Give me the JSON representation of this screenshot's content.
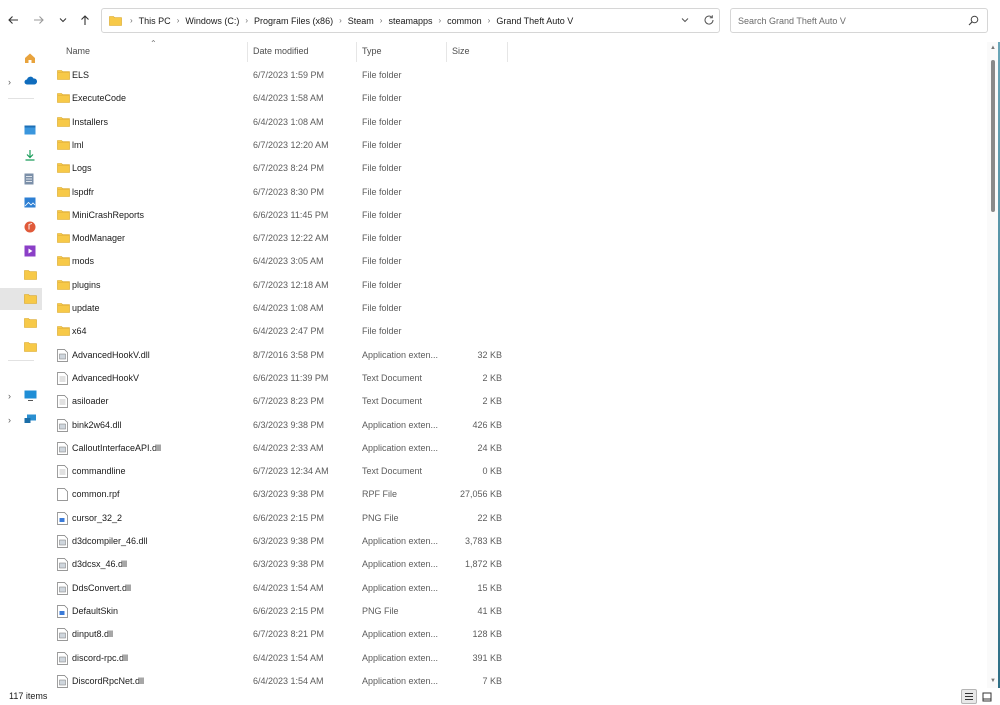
{
  "address": {
    "crumbs": [
      "This PC",
      "Windows (C:)",
      "Program Files (x86)",
      "Steam",
      "steamapps",
      "common",
      "Grand Theft Auto V"
    ]
  },
  "search": {
    "placeholder": "Search Grand Theft Auto V"
  },
  "columns": {
    "name": "Name",
    "date": "Date modified",
    "type": "Type",
    "size": "Size"
  },
  "files": [
    {
      "name": "ELS",
      "date": "6/7/2023 1:59 PM",
      "type": "File folder",
      "size": "",
      "kind": "folder"
    },
    {
      "name": "ExecuteCode",
      "date": "6/4/2023 1:58 AM",
      "type": "File folder",
      "size": "",
      "kind": "folder"
    },
    {
      "name": "Installers",
      "date": "6/4/2023 1:08 AM",
      "type": "File folder",
      "size": "",
      "kind": "folder"
    },
    {
      "name": "lml",
      "date": "6/7/2023 12:20 AM",
      "type": "File folder",
      "size": "",
      "kind": "folder"
    },
    {
      "name": "Logs",
      "date": "6/7/2023 8:24 PM",
      "type": "File folder",
      "size": "",
      "kind": "folder"
    },
    {
      "name": "lspdfr",
      "date": "6/7/2023 8:30 PM",
      "type": "File folder",
      "size": "",
      "kind": "folder"
    },
    {
      "name": "MiniCrashReports",
      "date": "6/6/2023 11:45 PM",
      "type": "File folder",
      "size": "",
      "kind": "folder"
    },
    {
      "name": "ModManager",
      "date": "6/7/2023 12:22 AM",
      "type": "File folder",
      "size": "",
      "kind": "folder"
    },
    {
      "name": "mods",
      "date": "6/4/2023 3:05 AM",
      "type": "File folder",
      "size": "",
      "kind": "folder"
    },
    {
      "name": "plugins",
      "date": "6/7/2023 12:18 AM",
      "type": "File folder",
      "size": "",
      "kind": "folder"
    },
    {
      "name": "update",
      "date": "6/4/2023 1:08 AM",
      "type": "File folder",
      "size": "",
      "kind": "folder"
    },
    {
      "name": "x64",
      "date": "6/4/2023 2:47 PM",
      "type": "File folder",
      "size": "",
      "kind": "folder"
    },
    {
      "name": "AdvancedHookV.dll",
      "date": "8/7/2016 3:58 PM",
      "type": "Application exten...",
      "size": "32 KB",
      "kind": "dll"
    },
    {
      "name": "AdvancedHookV",
      "date": "6/6/2023 11:39 PM",
      "type": "Text Document",
      "size": "2 KB",
      "kind": "txt"
    },
    {
      "name": "asiloader",
      "date": "6/7/2023 8:23 PM",
      "type": "Text Document",
      "size": "2 KB",
      "kind": "txt"
    },
    {
      "name": "bink2w64.dll",
      "date": "6/3/2023 9:38 PM",
      "type": "Application exten...",
      "size": "426 KB",
      "kind": "dll"
    },
    {
      "name": "CalloutInterfaceAPI.dll",
      "date": "6/4/2023 2:33 AM",
      "type": "Application exten...",
      "size": "24 KB",
      "kind": "dll"
    },
    {
      "name": "commandline",
      "date": "6/7/2023 12:34 AM",
      "type": "Text Document",
      "size": "0 KB",
      "kind": "txt"
    },
    {
      "name": "common.rpf",
      "date": "6/3/2023 9:38 PM",
      "type": "RPF File",
      "size": "27,056 KB",
      "kind": "blank"
    },
    {
      "name": "cursor_32_2",
      "date": "6/6/2023 2:15 PM",
      "type": "PNG File",
      "size": "22 KB",
      "kind": "png"
    },
    {
      "name": "d3dcompiler_46.dll",
      "date": "6/3/2023 9:38 PM",
      "type": "Application exten...",
      "size": "3,783 KB",
      "kind": "dll"
    },
    {
      "name": "d3dcsx_46.dll",
      "date": "6/3/2023 9:38 PM",
      "type": "Application exten...",
      "size": "1,872 KB",
      "kind": "dll"
    },
    {
      "name": "DdsConvert.dll",
      "date": "6/4/2023 1:54 AM",
      "type": "Application exten...",
      "size": "15 KB",
      "kind": "dll"
    },
    {
      "name": "DefaultSkin",
      "date": "6/6/2023 2:15 PM",
      "type": "PNG File",
      "size": "41 KB",
      "kind": "png"
    },
    {
      "name": "dinput8.dll",
      "date": "6/7/2023 8:21 PM",
      "type": "Application exten...",
      "size": "128 KB",
      "kind": "dll"
    },
    {
      "name": "discord-rpc.dll",
      "date": "6/4/2023 1:54 AM",
      "type": "Application exten...",
      "size": "391 KB",
      "kind": "dll"
    },
    {
      "name": "DiscordRpcNet.dll",
      "date": "6/4/2023 1:54 AM",
      "type": "Application exten...",
      "size": "7 KB",
      "kind": "dll"
    }
  ],
  "nav": [
    {
      "icon": "home-icon",
      "chevron": false
    },
    {
      "icon": "onedrive-icon",
      "chevron": true
    },
    {
      "icon": "desktop-icon",
      "chevron": false
    },
    {
      "icon": "downloads-icon",
      "chevron": false
    },
    {
      "icon": "documents-icon",
      "chevron": false
    },
    {
      "icon": "pictures-icon",
      "chevron": false
    },
    {
      "icon": "music-icon",
      "chevron": false
    },
    {
      "icon": "videos-icon",
      "chevron": false
    },
    {
      "icon": "folder-icon",
      "chevron": false
    },
    {
      "icon": "folder-icon",
      "chevron": false
    },
    {
      "icon": "folder-icon",
      "chevron": false
    },
    {
      "icon": "folder-icon",
      "chevron": false
    },
    {
      "icon": "this-pc-icon",
      "chevron": true
    },
    {
      "icon": "network-icon",
      "chevron": true
    }
  ],
  "status": {
    "item_count": "117 items"
  },
  "colors": {
    "folder": "#f7c948",
    "accent": "#0067c0"
  }
}
